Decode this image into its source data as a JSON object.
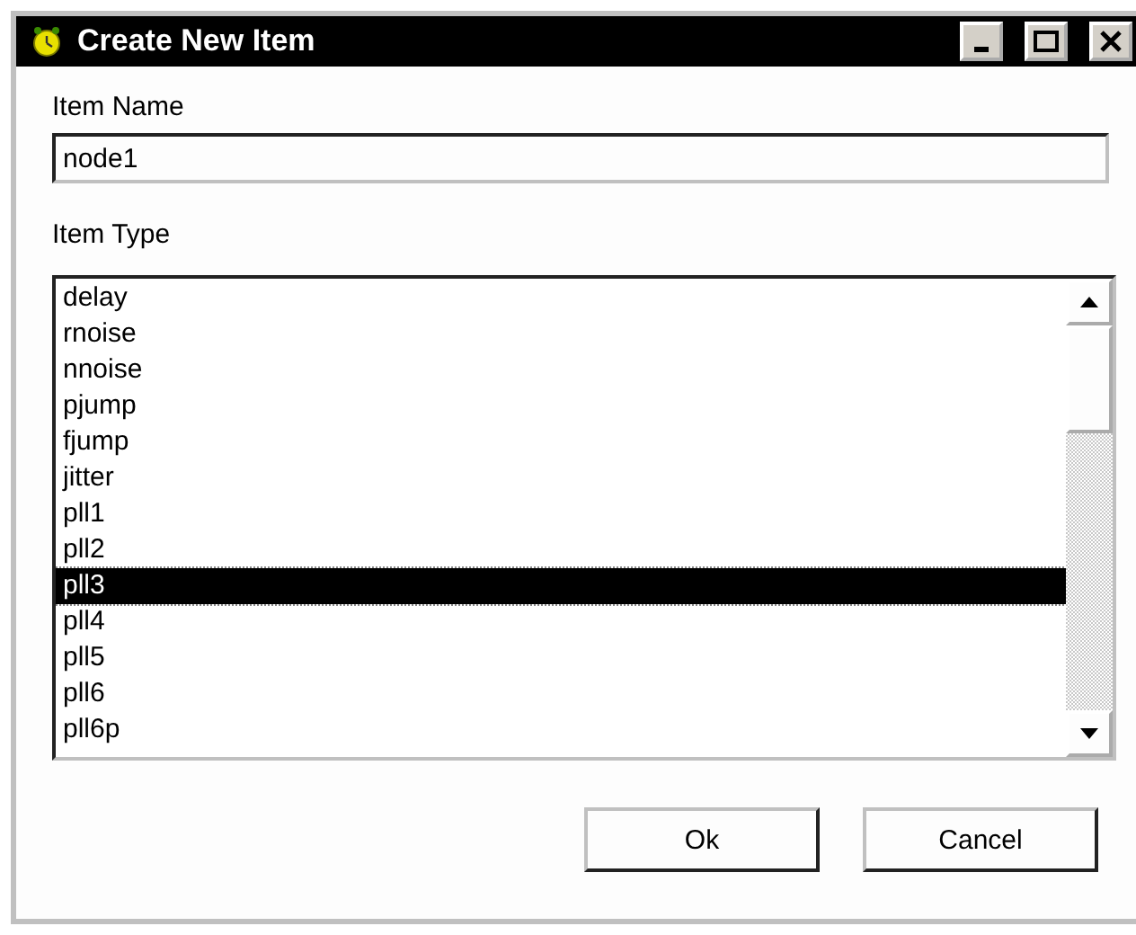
{
  "window": {
    "title": "Create New Item"
  },
  "name_field": {
    "label": "Item Name",
    "value": "node1"
  },
  "type_list": {
    "label": "Item Type",
    "items": [
      {
        "label": "delay",
        "selected": false
      },
      {
        "label": "rnoise",
        "selected": false
      },
      {
        "label": "nnoise",
        "selected": false
      },
      {
        "label": "pjump",
        "selected": false
      },
      {
        "label": "fjump",
        "selected": false
      },
      {
        "label": "jitter",
        "selected": false
      },
      {
        "label": "pll1",
        "selected": false
      },
      {
        "label": "pll2",
        "selected": false
      },
      {
        "label": "pll3",
        "selected": true
      },
      {
        "label": "pll4",
        "selected": false
      },
      {
        "label": "pll5",
        "selected": false
      },
      {
        "label": "pll6",
        "selected": false
      },
      {
        "label": "pll6p",
        "selected": false
      }
    ]
  },
  "buttons": [
    {
      "label": "Ok"
    },
    {
      "label": "Cancel"
    }
  ]
}
